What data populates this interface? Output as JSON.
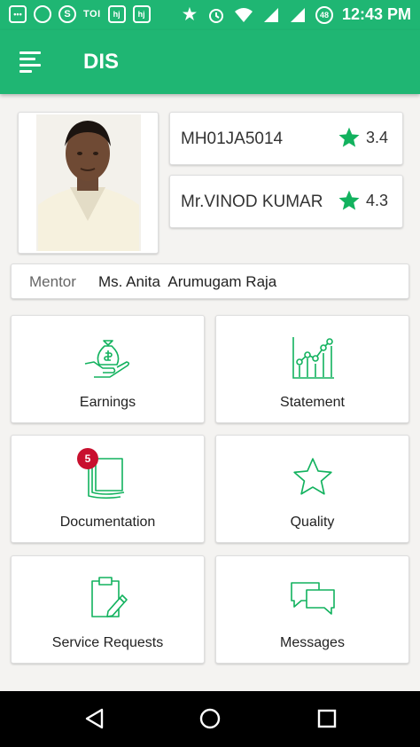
{
  "status_bar": {
    "left_icons": [
      "message-icon",
      "whatsapp-icon",
      "skype-icon",
      "toi-icon",
      "hj-icon",
      "hj-icon"
    ],
    "toi_label": "TOI",
    "hj_label": "hj",
    "battery_level": "48",
    "time": "12:43 PM"
  },
  "app_bar": {
    "title": "DIS",
    "menu_icon": "menu-icon"
  },
  "profile": {
    "vehicle_number": "MH01JA5014",
    "vehicle_rating": "3.4",
    "driver_name": "Mr.VINOD KUMAR",
    "driver_rating": "4.3",
    "mentor_label": "Mentor",
    "mentor_name": "Ms. Anita  Arumugam Raja"
  },
  "tiles": [
    {
      "label": "Earnings",
      "icon": "money-bag-hand-icon"
    },
    {
      "label": "Statement",
      "icon": "line-chart-icon"
    },
    {
      "label": "Documentation",
      "icon": "documents-icon",
      "badge": "5"
    },
    {
      "label": "Quality",
      "icon": "star-outline-icon"
    },
    {
      "label": "Service Requests",
      "icon": "clipboard-edit-icon"
    },
    {
      "label": "Messages",
      "icon": "chat-bubbles-icon"
    }
  ],
  "colors": {
    "primary": "#1fb673",
    "accent_green": "#12b25e",
    "badge_red": "#c8102e"
  },
  "nav_bar": {
    "icons": [
      "back-icon",
      "home-icon",
      "recents-icon"
    ]
  }
}
